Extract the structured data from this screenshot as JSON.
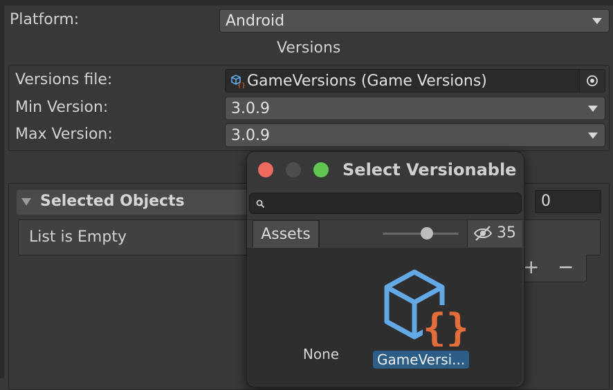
{
  "platform": {
    "label": "Platform:",
    "value": "Android"
  },
  "versions": {
    "heading": "Versions",
    "file_label": "Versions file:",
    "file_value": "GameVersions (Game Versions)",
    "min_label": "Min Version:",
    "min_value": "3.0.9",
    "max_label": "Max Version:",
    "max_value": "3.0.9"
  },
  "selected_objects": {
    "title": "Selected Objects",
    "count": "0",
    "empty_text": "List is Empty",
    "add_symbol": "+",
    "remove_symbol": "−"
  },
  "popup": {
    "title": "Select Versionable",
    "search_value": "",
    "tab_assets": "Assets",
    "zoom_fraction": 0.58,
    "hidden_count": "35",
    "items": [
      {
        "label": "None",
        "selected": false,
        "icon": null
      },
      {
        "label": "GameVersi...",
        "selected": true,
        "icon": "versionable-asset-icon"
      }
    ]
  },
  "colors": {
    "close": "#ed6a5e",
    "minimize_inactive": "#4d4d4d",
    "zoom": "#61c554",
    "selection": "#2c5d87",
    "icon_cube": "#62a9e6",
    "icon_braces": "#e06d3a"
  }
}
